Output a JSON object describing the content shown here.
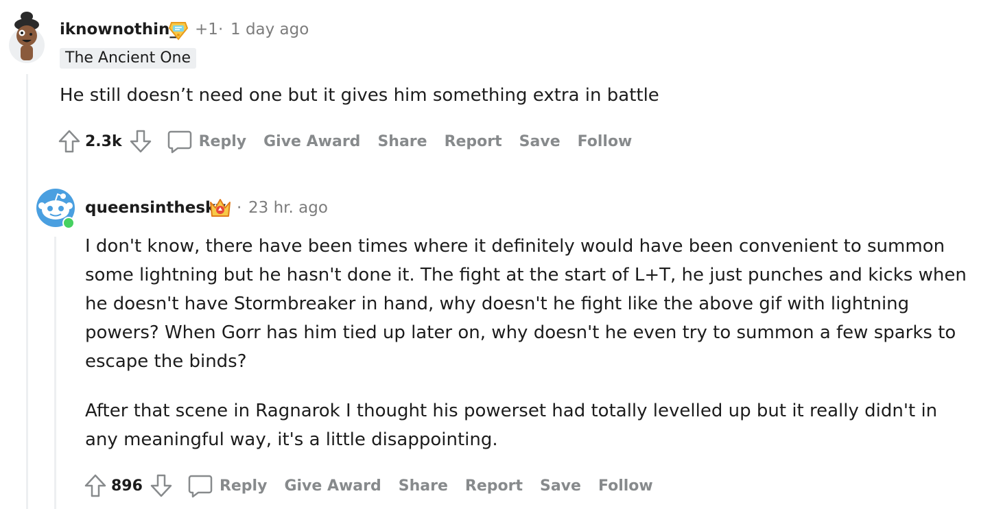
{
  "comments": [
    {
      "username": "iknownothin_",
      "karma_badge": "+1",
      "separator": "·",
      "timestamp": "1 day ago",
      "flair": "The Ancient One",
      "body": [
        "He still doesn’t need one but it gives him something extra in battle"
      ],
      "score": "2.3k",
      "actions": {
        "reply": "Reply",
        "give_award": "Give Award",
        "share": "Share",
        "report": "Report",
        "save": "Save",
        "follow": "Follow"
      }
    },
    {
      "username": "queensinthesky",
      "separator": "·",
      "timestamp": "23 hr. ago",
      "online": true,
      "body": [
        "I don't know, there have been times where it definitely would have been convenient to summon some lightning but he hasn't done it. The fight at the start of L+T, he just punches and kicks when he doesn't have Stormbreaker in hand, why doesn't he fight like the above gif with lightning powers? When Gorr has him tied up later on, why doesn't he even try to summon a few sparks to escape the binds?",
        "After that scene in Ragnarok I thought his powerset had totally levelled up but it really didn't in any meaningful way, it's a little disappointing."
      ],
      "score": "896",
      "actions": {
        "reply": "Reply",
        "give_award": "Give Award",
        "share": "Share",
        "report": "Report",
        "save": "Save",
        "follow": "Follow"
      }
    }
  ],
  "colors": {
    "text": "#1c1c1c",
    "meta": "#7c7c7c",
    "action": "#878a8c",
    "thread_line": "#edeff1",
    "online": "#46d160",
    "avatar_blue": "#4a9fe0"
  },
  "icons": {
    "upvote": "arrow-up-outline",
    "downvote": "arrow-down-outline",
    "reply": "speech-bubble-outline",
    "award_1": "trophy-award",
    "award_2": "crown-award"
  }
}
